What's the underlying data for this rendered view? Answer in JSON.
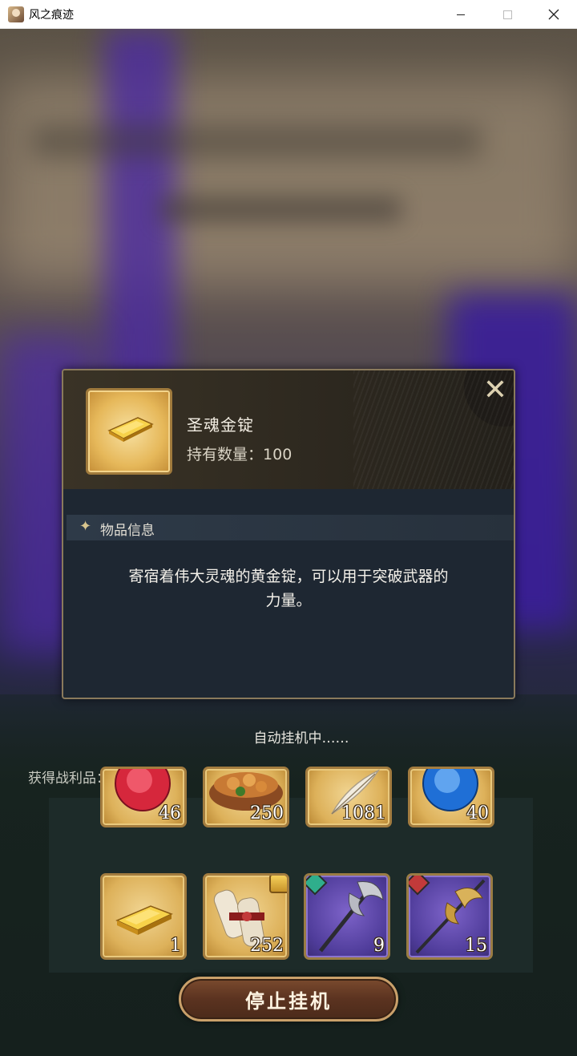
{
  "window": {
    "title": "风之痕迹",
    "controls": [
      "minimize-icon",
      "maximize-icon",
      "close-icon"
    ]
  },
  "item_dialog": {
    "name": "圣魂金锭",
    "count_label": "持有数量：",
    "count_value": "100",
    "icon": "gold-ingot-icon",
    "close_glyph": "✕",
    "section_title": "物品信息",
    "section_icon": "sparkle-icon",
    "section_glyph": "✦",
    "description_line1": "寄宿着伟大灵魂的黄金锭，可以用于突破武器的",
    "description_line2": "力量。"
  },
  "status_text": "自动挂机中……",
  "loot_label": "获得战利品：",
  "loot_rows": [
    [
      {
        "icon": "red-orb-icon",
        "count": "46"
      },
      {
        "icon": "food-pot-icon",
        "count": "250"
      },
      {
        "icon": "feather-icon",
        "count": "1081"
      },
      {
        "icon": "blue-orb-icon",
        "count": "40"
      }
    ],
    [
      {
        "icon": "gold-ingot-icon",
        "count": "1"
      },
      {
        "icon": "scroll-bundle-icon",
        "count": "252",
        "badge": "treasure-chest-icon"
      },
      {
        "icon": "battle-axe-icon",
        "count": "9",
        "badge": "wind-element-icon"
      },
      {
        "icon": "halberd-icon",
        "count": "15",
        "badge": "fire-element-icon"
      }
    ]
  ],
  "stop_button": "停止挂机",
  "colors": {
    "gold_frame": "#a37c3f",
    "dialog_bg": "#1e2732",
    "purple_slot": "#4f3c9a",
    "button_brown": "#5b3320"
  }
}
